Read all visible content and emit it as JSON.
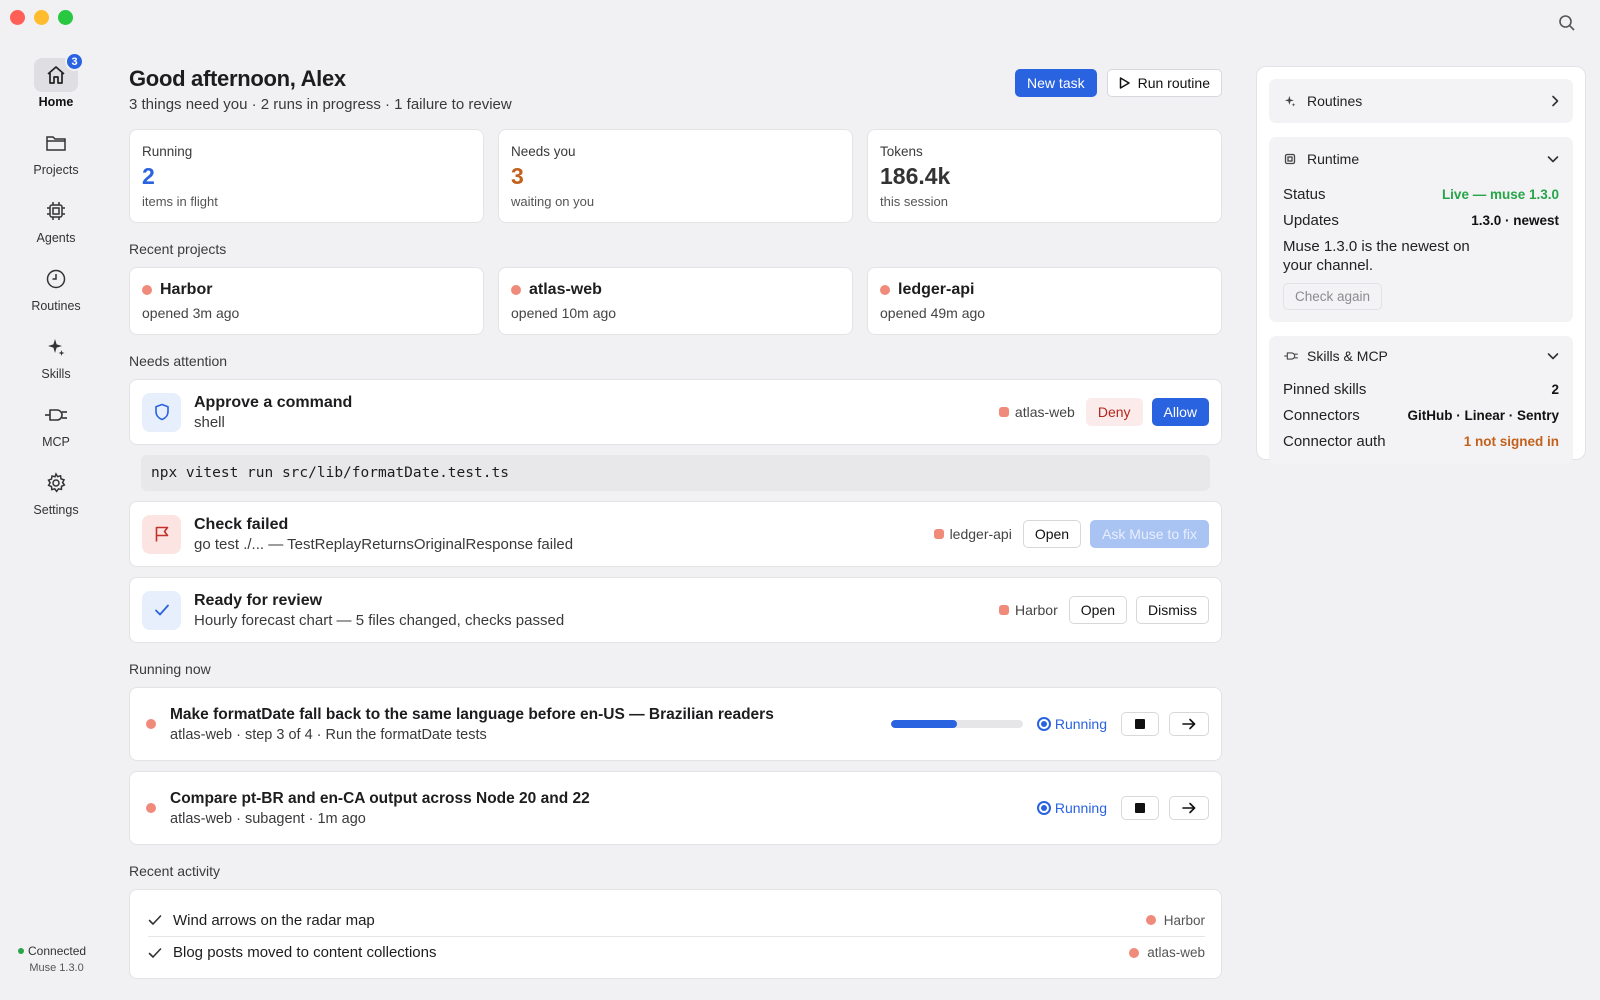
{
  "sidebar": {
    "items": [
      {
        "label": "Home",
        "icon": "home-icon",
        "badge": "3"
      },
      {
        "label": "Projects",
        "icon": "folder-icon"
      },
      {
        "label": "Agents",
        "icon": "chip-icon"
      },
      {
        "label": "Routines",
        "icon": "clock-icon"
      },
      {
        "label": "Skills",
        "icon": "sparkle-icon"
      },
      {
        "label": "MCP",
        "icon": "plug-icon"
      },
      {
        "label": "Settings",
        "icon": "gear-icon"
      }
    ],
    "connection": {
      "status": "Connected",
      "version": "Muse 1.3.0"
    }
  },
  "header": {
    "greeting": "Good afternoon, Alex",
    "subtitle": "3 things need you · 2 runs in progress · 1 failure to review",
    "new_task_label": "New task",
    "run_routine_label": "Run routine"
  },
  "stats": [
    {
      "label": "Running",
      "value": "2",
      "sub": "items in flight"
    },
    {
      "label": "Needs you",
      "value": "3",
      "sub": "waiting on you"
    },
    {
      "label": "Tokens",
      "value": "186.4k",
      "sub": "this session"
    }
  ],
  "recent_projects": {
    "title": "Recent projects",
    "items": [
      {
        "name": "Harbor",
        "sub": "opened 3m ago"
      },
      {
        "name": "atlas-web",
        "sub": "opened 10m ago"
      },
      {
        "name": "ledger-api",
        "sub": "opened 49m ago"
      }
    ]
  },
  "attention": {
    "title": "Needs attention",
    "approve": {
      "title": "Approve a command",
      "desc": "shell",
      "project": "atlas-web",
      "deny_label": "Deny",
      "allow_label": "Allow",
      "command": "npx vitest run src/lib/formatDate.test.ts"
    },
    "failed": {
      "title": "Check failed",
      "desc": "go test ./... — TestReplayReturnsOriginalResponse failed",
      "project": "ledger-api",
      "open_label": "Open",
      "fix_label": "Ask Muse to fix"
    },
    "review": {
      "title": "Ready for review",
      "desc": "Hourly forecast chart — 5 files changed, checks passed",
      "project": "Harbor",
      "open_label": "Open",
      "dismiss_label": "Dismiss"
    }
  },
  "running": {
    "title": "Running now",
    "items": [
      {
        "title": "Make formatDate fall back to the same language before en-US — Brazilian readers",
        "desc": "atlas-web · step 3 of 4 · Run the formatDate tests",
        "status": "Running",
        "progress": 0.5
      },
      {
        "title": "Compare pt-BR and en-CA output across Node 20 and 22",
        "desc": "atlas-web · subagent · 1m ago",
        "status": "Running"
      }
    ]
  },
  "activity": {
    "title": "Recent activity",
    "items": [
      {
        "text": "Wind arrows on the radar map",
        "project": "Harbor"
      },
      {
        "text": "Blog posts moved to content collections",
        "project": "atlas-web"
      }
    ]
  },
  "right_panel": {
    "routines": {
      "title": "Routines"
    },
    "runtime": {
      "title": "Runtime",
      "status_key": "Status",
      "status_val": "Live — muse 1.3.0",
      "updates_key": "Updates",
      "updates_val": "1.3.0 · newest",
      "note": "Muse 1.3.0 is the newest on your channel.",
      "check_label": "Check again"
    },
    "skills": {
      "title": "Skills & MCP",
      "pinned_key": "Pinned skills",
      "pinned_val": "2",
      "connectors_key": "Connectors",
      "connectors_val": "GitHub · Linear · Sentry",
      "auth_key": "Connector auth",
      "auth_val": "1 not signed in"
    }
  },
  "colors": {
    "accent": "#2a63e0",
    "project_dot": "#f08a7a",
    "live": "#27a548",
    "warning": "#c2611c"
  }
}
